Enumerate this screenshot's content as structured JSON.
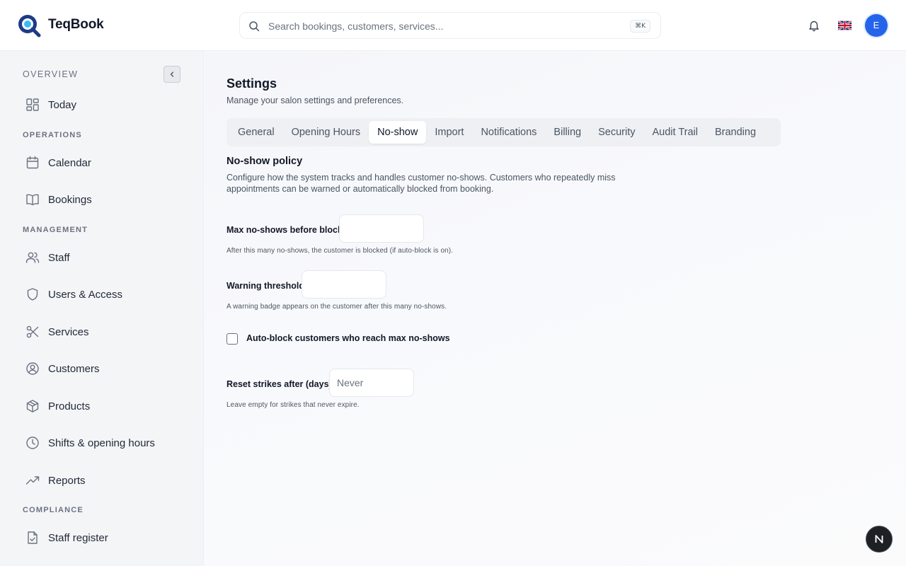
{
  "header": {
    "brand": "TeqBook",
    "search_placeholder": "Search bookings, customers, services...",
    "search_shortcut": "⌘K",
    "avatar_initial": "E",
    "accent_color": "#2563eb"
  },
  "sidebar": {
    "sections": {
      "overview": "OVERVIEW",
      "operations": "OPERATIONS",
      "management": "MANAGEMENT",
      "compliance": "COMPLIANCE"
    },
    "items": [
      {
        "label": "Today",
        "icon": "grid-icon"
      },
      {
        "label": "Calendar",
        "icon": "calendar-icon"
      },
      {
        "label": "Bookings",
        "icon": "book-icon"
      },
      {
        "label": "Staff",
        "icon": "users-icon"
      },
      {
        "label": "Users & Access",
        "icon": "shield-icon"
      },
      {
        "label": "Services",
        "icon": "scissors-icon"
      },
      {
        "label": "Customers",
        "icon": "user-circle-icon"
      },
      {
        "label": "Products",
        "icon": "package-icon"
      },
      {
        "label": "Shifts & opening hours",
        "icon": "clock-icon"
      },
      {
        "label": "Reports",
        "icon": "trending-up-icon"
      },
      {
        "label": "Staff register",
        "icon": "file-check-icon"
      }
    ]
  },
  "main": {
    "title": "Settings",
    "subtitle": "Manage your salon settings and preferences.",
    "tabs": [
      {
        "label": "General"
      },
      {
        "label": "Opening Hours"
      },
      {
        "label": "No-show",
        "active": true
      },
      {
        "label": "Import"
      },
      {
        "label": "Notifications"
      },
      {
        "label": "Billing"
      },
      {
        "label": "Security"
      },
      {
        "label": "Audit Trail"
      },
      {
        "label": "Branding"
      }
    ],
    "policy": {
      "title": "No-show policy",
      "description": "Configure how the system tracks and handles customer no-shows. Customers who repeatedly miss appointments can be warned or automatically blocked from booking."
    },
    "fields": {
      "max_noshows": {
        "label": "Max no-shows before block",
        "value": "",
        "hint": "After this many no-shows, the customer is blocked (if auto-block is on)."
      },
      "warning_threshold": {
        "label": "Warning threshold",
        "value": "",
        "hint": "A warning badge appears on the customer after this many no-shows."
      },
      "auto_block": {
        "label": "Auto-block customers who reach max no-shows",
        "checked": false
      },
      "reset_strikes": {
        "label": "Reset strikes after (days)",
        "value": "",
        "placeholder": "Never",
        "hint": "Leave empty for strikes that never expire."
      }
    }
  },
  "dev_badge": "N"
}
